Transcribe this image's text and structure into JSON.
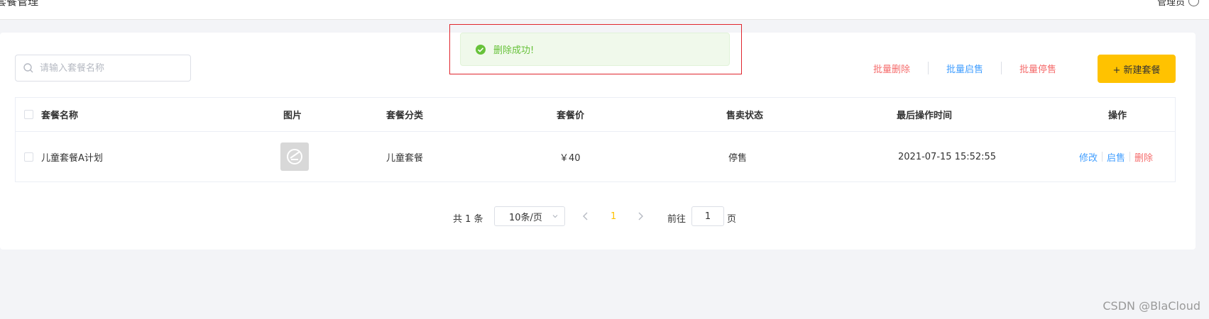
{
  "header": {
    "title": "套餐管理",
    "user": "管理员"
  },
  "search": {
    "placeholder": "请输入套餐名称"
  },
  "actions": {
    "batch_delete": "批量删除",
    "batch_enable": "批量启售",
    "batch_disable": "批量停售",
    "new_combo": "+ 新建套餐"
  },
  "table": {
    "columns": [
      "套餐名称",
      "图片",
      "套餐分类",
      "套餐价",
      "售卖状态",
      "最后操作时间",
      "操作"
    ],
    "rows": [
      {
        "name": "儿童套餐A计划",
        "category": "儿童套餐",
        "price": "￥40",
        "status": "停售",
        "updated": "2021-07-15 15:52:55",
        "ops": {
          "edit": "修改",
          "enable": "启售",
          "delete": "删除"
        }
      }
    ]
  },
  "pagination": {
    "total": "共 1 条",
    "page_size": "10条/页",
    "current_page": "1",
    "goto_label": "前往",
    "goto_value": "1",
    "goto_suffix": "页"
  },
  "toast": {
    "message": "删除成功!"
  },
  "watermark": "CSDN @BlaCloud",
  "colors": {
    "accent": "#ffc200",
    "danger": "#f56c6c",
    "link": "#419eff",
    "success": "#67c23a"
  }
}
